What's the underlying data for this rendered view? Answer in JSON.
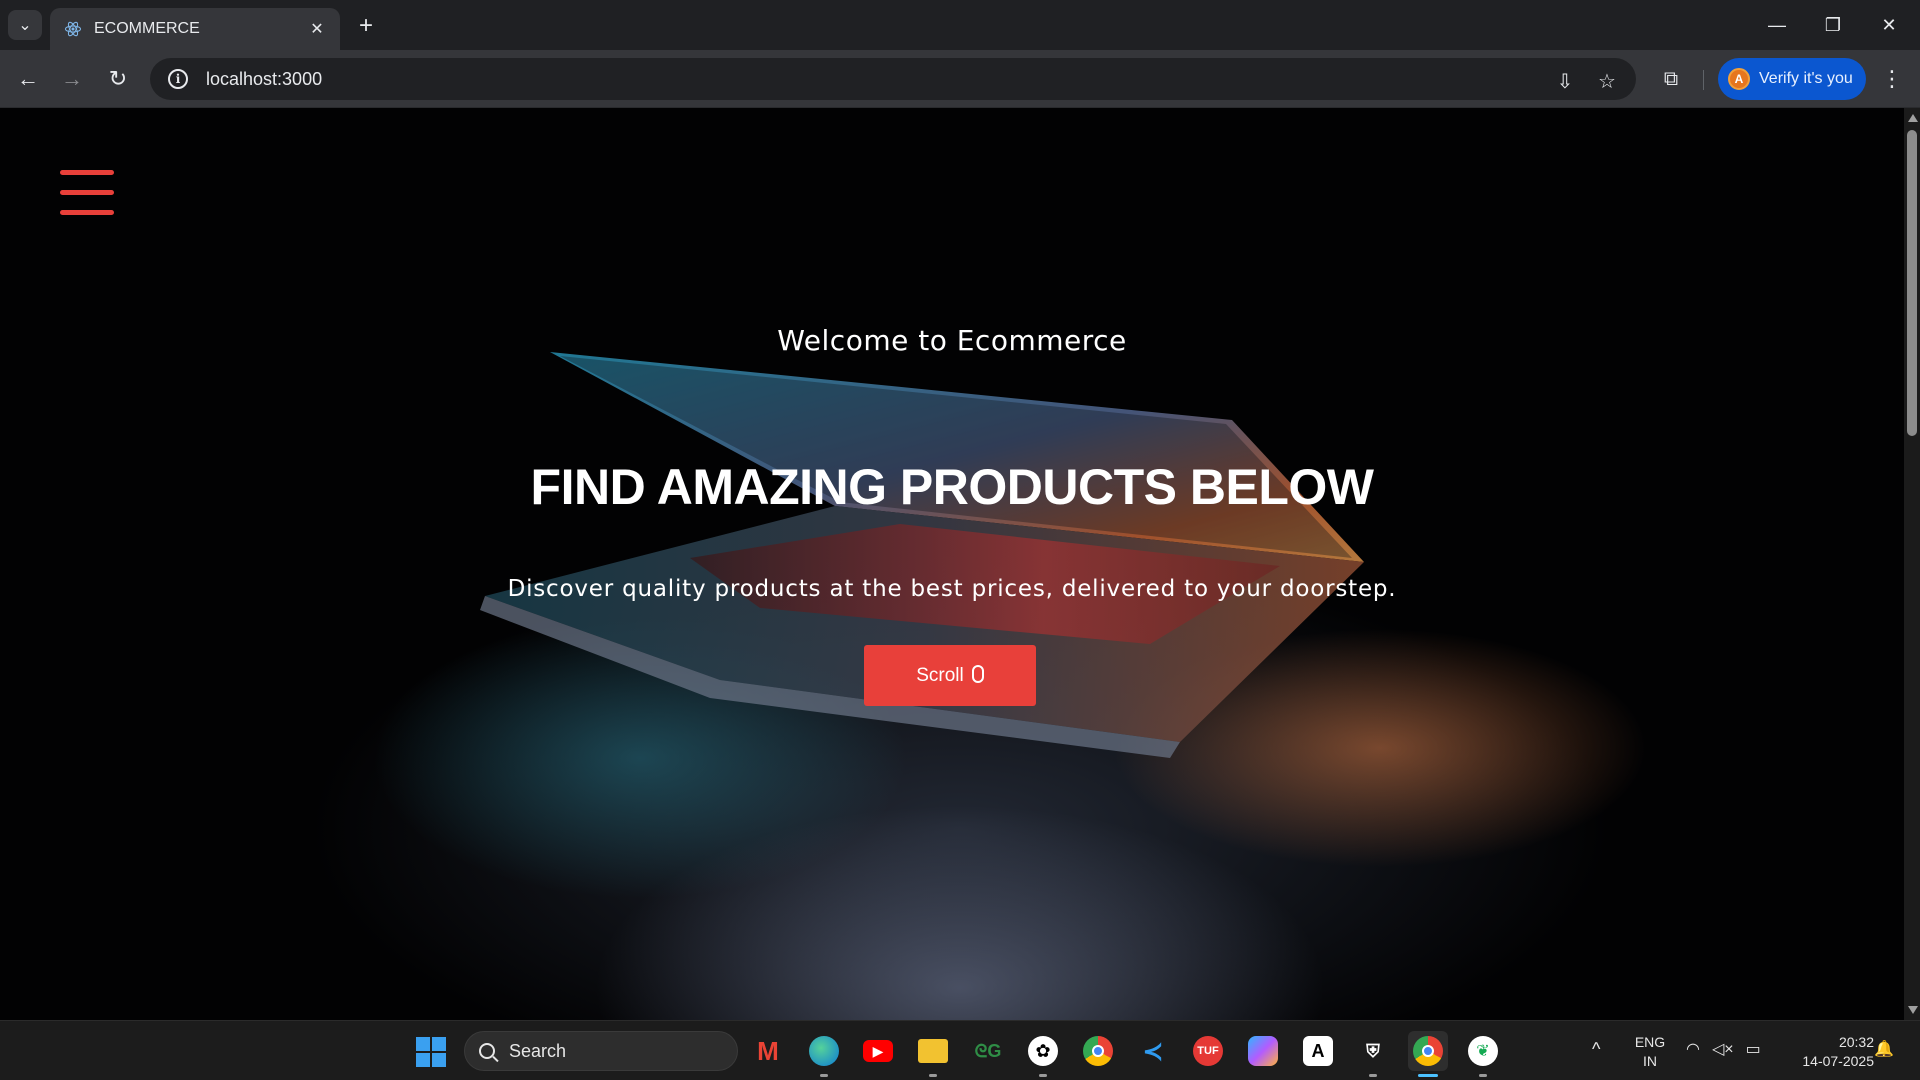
{
  "browser": {
    "tab_title": "ECOMMERCE",
    "url": "localhost:3000",
    "profile_initial": "A",
    "verify_label": "Verify it's you"
  },
  "page": {
    "welcome": "Welcome to Ecommerce",
    "headline": "FIND AMAZING PRODUCTS BELOW",
    "subtitle": "Discover quality products at the best prices, delivered to your doorstep.",
    "scroll_label": "Scroll",
    "accent_color": "#e8403a"
  },
  "taskbar": {
    "search_placeholder": "Search",
    "lang_line1": "ENG",
    "lang_line2": "IN",
    "time": "20:32",
    "date": "14-07-2025",
    "apps": [
      "gmail-icon",
      "edge-icon",
      "youtube-icon",
      "file-explorer-icon",
      "geeksforgeeks-icon",
      "chatgpt-icon",
      "chrome-icon",
      "vscode-icon",
      "tuf-icon",
      "copilot-icon",
      "adobe-icon",
      "app-icon",
      "chrome-active-icon",
      "mongodb-icon"
    ]
  }
}
